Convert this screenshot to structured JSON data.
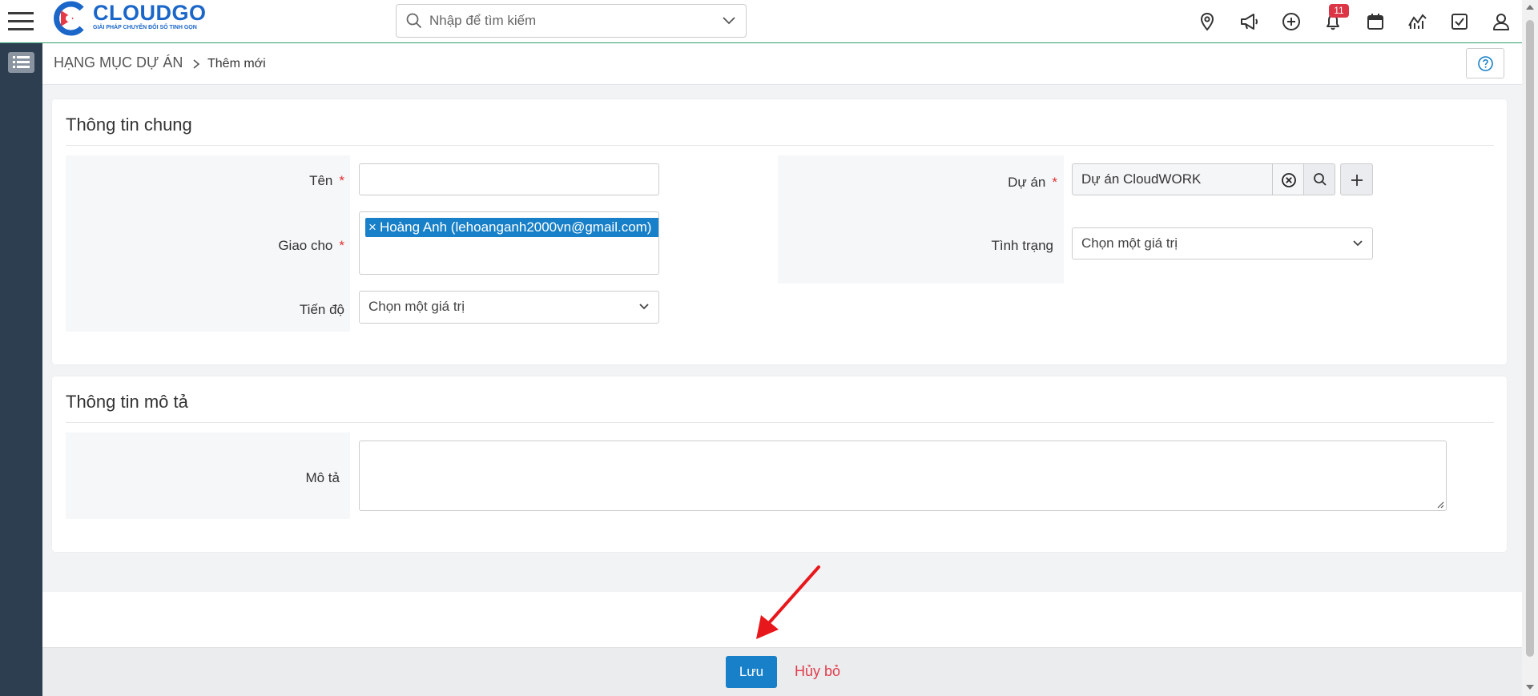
{
  "brand": {
    "name": "CLOUDGO",
    "tagline": "GIẢI PHÁP CHUYỂN ĐỔI SỐ TINH GỌN"
  },
  "search": {
    "placeholder": "Nhập để tìm kiếm",
    "value": ""
  },
  "header_icons": [
    "map-pin-icon",
    "megaphone-icon",
    "plus-circle-icon",
    "bell-icon",
    "calendar-icon",
    "chart-line-icon",
    "checkbox-icon",
    "user-icon"
  ],
  "notifications": {
    "count": "11"
  },
  "breadcrumb": {
    "root": "HẠNG MỤC DỰ ÁN",
    "separator": ">",
    "current": "Thêm mới"
  },
  "general_section": {
    "title": "Thông tin chung",
    "name_field": {
      "label": "Tên",
      "required": "*",
      "value": ""
    },
    "assign_field": {
      "label": "Giao cho",
      "required": "*",
      "tag_remove": "×",
      "tag": "Hoàng Anh (lehoanganh2000vn@gmail.com)"
    },
    "progress_field": {
      "label": "Tiến độ",
      "value": "Chọn một giá trị"
    },
    "project_field": {
      "label": "Dự án",
      "required": "*",
      "value": "Dự án CloudWORK"
    },
    "status_field": {
      "label": "Tình trạng",
      "value": "Chọn một giá trị"
    }
  },
  "description_section": {
    "title": "Thông tin mô tả",
    "description_field": {
      "label": "Mô tả",
      "value": ""
    }
  },
  "footer": {
    "save_label": "Lưu",
    "cancel_label": "Hủy bỏ"
  },
  "colors": {
    "primary": "#1880c8",
    "sidebar": "#2c3e50",
    "accent_green": "#2e9e6b",
    "danger": "#e03c4b",
    "arrow_annotation": "#e8171b"
  }
}
